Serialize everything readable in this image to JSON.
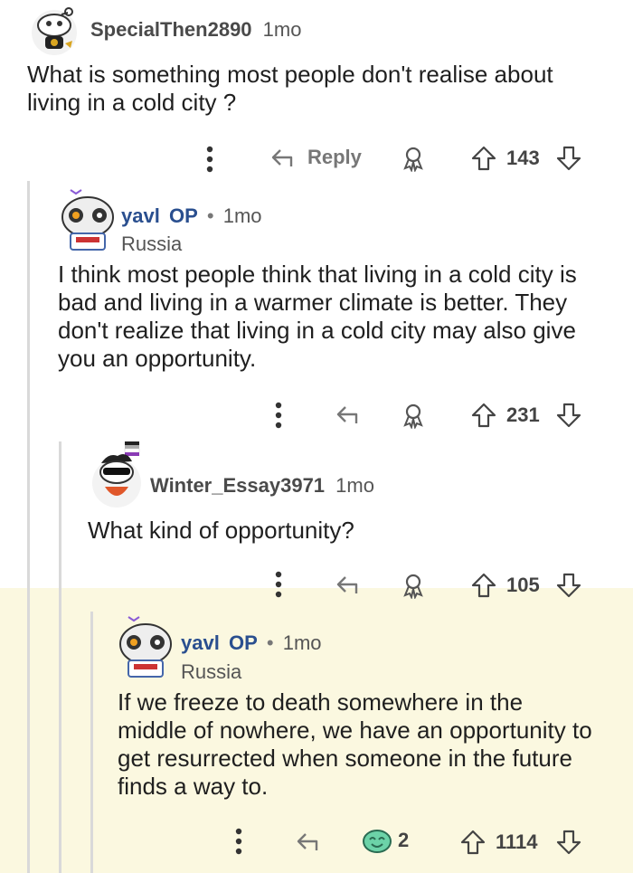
{
  "comments": [
    {
      "username": "SpecialThen2890",
      "time": "1mo",
      "body": "What is something most people don't realise about living in a cold city ?",
      "actions": {
        "reply_label": "Reply",
        "score": "143"
      }
    },
    {
      "username": "yavl",
      "op_badge": "OP",
      "separator": "•",
      "time": "1mo",
      "flair": "Russia",
      "body": "I think most people think that living in a cold city is bad and living in a warmer climate is better. They don't realize that living in a cold city may also give you an opportunity.",
      "actions": {
        "score": "231"
      }
    },
    {
      "username": "Winter_Essay3971",
      "time": "1mo",
      "body": "What kind of opportunity?",
      "actions": {
        "score": "105"
      }
    },
    {
      "username": "yavl",
      "op_badge": "OP",
      "separator": "•",
      "time": "1mo",
      "flair": "Russia",
      "body": "If we freeze to death somewhere in the middle of nowhere, we have an opportunity to get resurrected when someone in the future finds a way to.",
      "actions": {
        "award_count": "2",
        "score": "1114"
      }
    }
  ],
  "colors": {
    "highlight_bg": "#fbf8e0",
    "op_blue": "#2a4f8f",
    "thread_line": "#d9d9d9"
  }
}
